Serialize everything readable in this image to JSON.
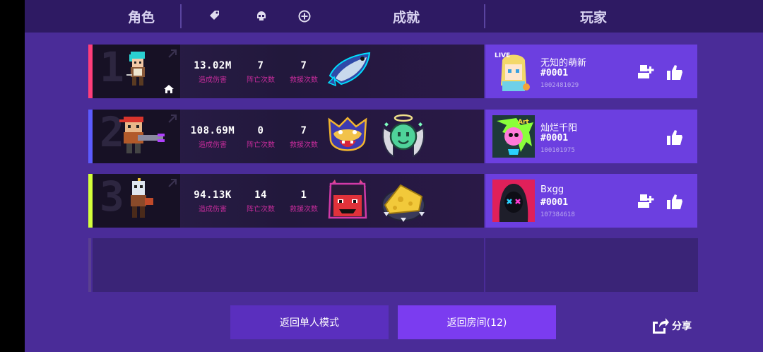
{
  "header": {
    "col_character": "角色",
    "col_achievement": "成就",
    "col_player": "玩家",
    "icons": [
      "tag-icon",
      "skull-icon",
      "plus-circle-icon"
    ]
  },
  "stat_labels": {
    "damage": "造成伤害",
    "deaths": "阵亡次数",
    "rescues": "救援次数"
  },
  "rows": [
    {
      "rank": "1",
      "accent_color": "#ff3d7a",
      "character": "teal-haired-swordsman-sprite",
      "home_icon": true,
      "damage": "13.02M",
      "deaths": "7",
      "rescues": "7",
      "badges": [
        "fish-badge"
      ],
      "player": {
        "name": "无知的萌新",
        "tag": "#0001",
        "id": "1002481029",
        "avatar": "blonde-live-girl-avatar",
        "show_add_friend": true
      }
    },
    {
      "rank": "2",
      "accent_color": "#5b5bff",
      "character": "red-bandana-gunner-sprite",
      "home_icon": false,
      "damage": "108.69M",
      "deaths": "0",
      "rescues": "7",
      "badges": [
        "wolf-badge",
        "angel-slime-badge"
      ],
      "player": {
        "name": "灿烂千阳",
        "tag": "#0001",
        "id": "100101975",
        "avatar": "graffiti-avatar",
        "show_add_friend": false
      }
    },
    {
      "rank": "3",
      "accent_color": "#d4ff3a",
      "character": "masked-knight-sprite",
      "home_icon": false,
      "damage": "94.13K",
      "deaths": "14",
      "rescues": "1",
      "badges": [
        "red-demon-badge",
        "cheese-badge"
      ],
      "player": {
        "name": "Bxgg",
        "tag": "#0001",
        "id": "107384618",
        "avatar": "hooded-figure-avatar",
        "show_add_friend": true
      }
    }
  ],
  "buttons": {
    "single_mode": "返回单人模式",
    "room": "返回房间(12)",
    "share": "分享"
  },
  "colors": {
    "background": "#4a2c98",
    "header": "#2e1a63",
    "player_panel": "#6c3fe0",
    "label_magenta": "#c42c9a",
    "room_button": "#7b3cf0",
    "single_button": "#5a2fbe"
  }
}
